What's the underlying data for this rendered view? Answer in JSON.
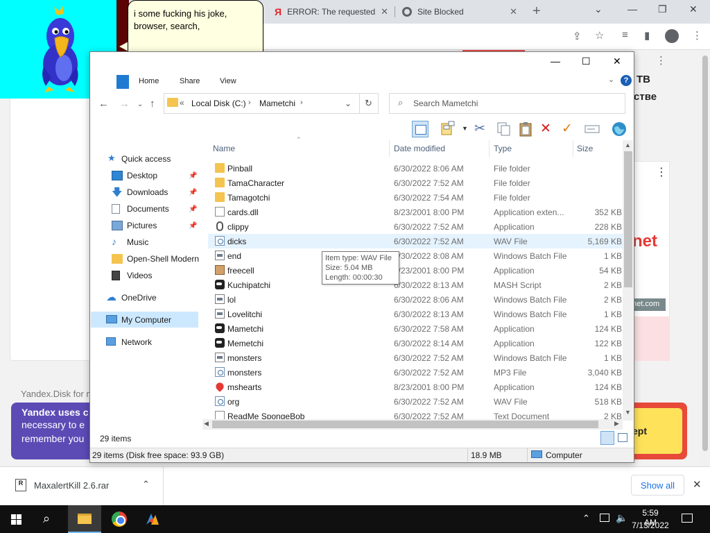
{
  "browser": {
    "tabs": [
      {
        "title": "ERROR: The requested",
        "favicon": "yandex-icon"
      },
      {
        "title": "Site Blocked",
        "favicon": "globe-icon"
      }
    ],
    "page": {
      "right_heading_1": "ТВ",
      "right_heading_2": "стве",
      "ad_brand_fragment": "net",
      "ad_domain": "net.com",
      "yandex_disk_text": "Yandex.Disk for m",
      "cookie_title": "Yandex uses c",
      "cookie_line_1": "necessary to e",
      "cookie_line_2": "remember you",
      "accept_label": "ept"
    },
    "download": {
      "filename": "MaxalertKill 2.6.rar",
      "show_all": "Show all"
    }
  },
  "bird": {
    "speech": "i some fucking his joke, browser, search,"
  },
  "explorer": {
    "ribbon_tabs": [
      "Home",
      "Share",
      "View"
    ],
    "address": {
      "crumbs": [
        "Local Disk (C:)",
        "Mametchi"
      ],
      "prefix": "«"
    },
    "search_placeholder": "Search Mametchi",
    "nav": [
      {
        "label": "Quick access",
        "icon": "star-icon",
        "pinned": false
      },
      {
        "label": "Desktop",
        "icon": "desktop-icon",
        "pinned": true
      },
      {
        "label": "Downloads",
        "icon": "download-arrow-icon",
        "pinned": true
      },
      {
        "label": "Documents",
        "icon": "documents-icon",
        "pinned": true
      },
      {
        "label": "Pictures",
        "icon": "pictures-icon",
        "pinned": true
      },
      {
        "label": "Music",
        "icon": "music-note-icon",
        "pinned": false
      },
      {
        "label": "Open-Shell Modern",
        "icon": "folder-icon",
        "pinned": false
      },
      {
        "label": "Videos",
        "icon": "film-icon",
        "pinned": false
      },
      {
        "label": "OneDrive",
        "icon": "cloud-icon",
        "pinned": false
      },
      {
        "label": "My Computer",
        "icon": "computer-icon",
        "pinned": false,
        "selected": true
      },
      {
        "label": "Network",
        "icon": "network-icon",
        "pinned": false
      }
    ],
    "columns": [
      "Name",
      "Date modified",
      "Type",
      "Size"
    ],
    "files": [
      {
        "name": "Pinball",
        "date": "6/30/2022 8:06 AM",
        "type": "File folder",
        "size": "",
        "icon": "folder-icon"
      },
      {
        "name": "TamaCharacter",
        "date": "6/30/2022 7:52 AM",
        "type": "File folder",
        "size": "",
        "icon": "folder-icon"
      },
      {
        "name": "Tamagotchi",
        "date": "6/30/2022 7:54 AM",
        "type": "File folder",
        "size": "",
        "icon": "folder-icon"
      },
      {
        "name": "cards.dll",
        "date": "8/23/2001 8:00 PM",
        "type": "Application exten...",
        "size": "352 KB",
        "icon": "dll-icon"
      },
      {
        "name": "clippy",
        "date": "6/30/2022 7:52 AM",
        "type": "Application",
        "size": "228 KB",
        "icon": "paperclip-icon"
      },
      {
        "name": "dicks",
        "date": "6/30/2022 7:52 AM",
        "type": "WAV File",
        "size": "5,169 KB",
        "icon": "audio-file-icon"
      },
      {
        "name": "end",
        "date": "6/30/2022 8:08 AM",
        "type": "Windows Batch File",
        "size": "1 KB",
        "icon": "batch-file-icon"
      },
      {
        "name": "freecell",
        "date": "8/23/2001 8:00 PM",
        "type": "Application",
        "size": "54 KB",
        "icon": "cards-icon"
      },
      {
        "name": "Kuchipatchi",
        "date": "6/30/2022 8:13 AM",
        "type": "MASH Script",
        "size": "2 KB",
        "icon": "character-icon"
      },
      {
        "name": "lol",
        "date": "6/30/2022 8:06 AM",
        "type": "Windows Batch File",
        "size": "2 KB",
        "icon": "batch-file-icon"
      },
      {
        "name": "Lovelitchi",
        "date": "6/30/2022 8:13 AM",
        "type": "Windows Batch File",
        "size": "1 KB",
        "icon": "batch-file-icon"
      },
      {
        "name": "Mametchi",
        "date": "6/30/2022 7:58 AM",
        "type": "Application",
        "size": "124 KB",
        "icon": "character-icon"
      },
      {
        "name": "Memetchi",
        "date": "6/30/2022 8:14 AM",
        "type": "Application",
        "size": "122 KB",
        "icon": "character-icon"
      },
      {
        "name": "monsters",
        "date": "6/30/2022 7:52 AM",
        "type": "Windows Batch File",
        "size": "1 KB",
        "icon": "batch-file-icon"
      },
      {
        "name": "monsters",
        "date": "6/30/2022 7:52 AM",
        "type": "MP3 File",
        "size": "3,040 KB",
        "icon": "audio-file-icon"
      },
      {
        "name": "mshearts",
        "date": "8/23/2001 8:00 PM",
        "type": "Application",
        "size": "124 KB",
        "icon": "heart-icon"
      },
      {
        "name": "org",
        "date": "6/30/2022 7:52 AM",
        "type": "WAV File",
        "size": "518 KB",
        "icon": "audio-file-icon"
      },
      {
        "name": "ReadMe SpongeBob",
        "date": "6/30/2022 7:52 AM",
        "type": "Text Document",
        "size": "2 KB",
        "icon": "text-file-icon"
      }
    ],
    "tooltip": {
      "line1": "Item type: WAV File",
      "line2": "Size: 5.04 MB",
      "line3": "Length: 00:00:30"
    },
    "items_count": "29 items",
    "status": {
      "left": "29 items (Disk free space: 93.9 GB)",
      "size": "18.9 MB",
      "location": "Computer"
    }
  },
  "taskbar": {
    "time": "5:59 AM",
    "date": "7/13/2022"
  }
}
